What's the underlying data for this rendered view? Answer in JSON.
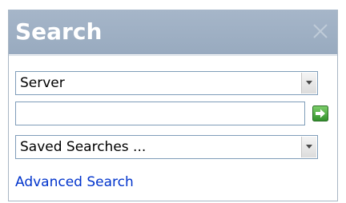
{
  "panel": {
    "title": "Search",
    "close_icon": "close-icon"
  },
  "server_select": {
    "value": "Server"
  },
  "search_input": {
    "value": "",
    "placeholder": ""
  },
  "go_button": {
    "icon": "go-arrow-icon",
    "color": "#3fa33a"
  },
  "saved_select": {
    "value": "Saved Searches ..."
  },
  "advanced_link": {
    "label": "Advanced Search"
  },
  "colors": {
    "title_bar": "#9fb0c4",
    "link": "#0033cc"
  }
}
